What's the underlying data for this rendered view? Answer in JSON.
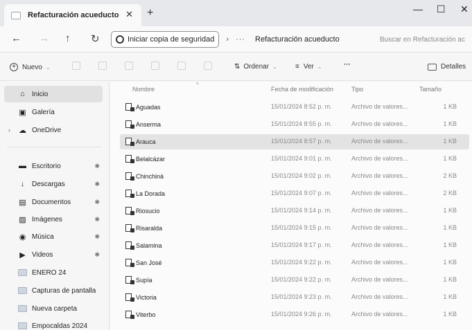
{
  "window": {
    "tab_title": "Refacturación acueducto",
    "close_tab": "✕",
    "new_tab": "+",
    "minimize": "—",
    "maximize": "☐",
    "close": "✕"
  },
  "address": {
    "back": "←",
    "forward": "→",
    "up": "↑",
    "refresh": "↻",
    "backup_label": "Iniciar copia de seguridad",
    "separator": "›",
    "more": "···",
    "current_folder": "Refacturación acueducto",
    "search_placeholder": "Buscar en Refacturación ac"
  },
  "command_bar": {
    "new_label": "Nuevo",
    "sort_label": "Ordenar",
    "view_label": "Ver",
    "more": "···",
    "details_label": "Detalles"
  },
  "sidebar": {
    "top": [
      {
        "label": "Inicio",
        "icon": "home-icon",
        "glyph": "⌂"
      },
      {
        "label": "Galería",
        "icon": "gallery-icon",
        "glyph": "▣"
      },
      {
        "label": "OneDrive",
        "icon": "cloud-icon",
        "glyph": "☁"
      }
    ],
    "quick": [
      {
        "label": "Escritorio",
        "icon": "desktop-icon",
        "glyph": "▬",
        "pinned": true
      },
      {
        "label": "Descargas",
        "icon": "download-icon",
        "glyph": "↓",
        "pinned": true
      },
      {
        "label": "Documentos",
        "icon": "documents-icon",
        "glyph": "▤",
        "pinned": true
      },
      {
        "label": "Imágenes",
        "icon": "pictures-icon",
        "glyph": "▨",
        "pinned": true
      },
      {
        "label": "Música",
        "icon": "music-icon",
        "glyph": "◉",
        "pinned": true
      },
      {
        "label": "Videos",
        "icon": "videos-icon",
        "glyph": "▶",
        "pinned": true
      },
      {
        "label": "ENERO 24",
        "icon": "folder-icon"
      },
      {
        "label": "Capturas de pantalla",
        "icon": "folder-icon"
      },
      {
        "label": "Nueva carpeta",
        "icon": "folder-icon"
      },
      {
        "label": "Empocaldas 2024",
        "icon": "folder-icon"
      }
    ],
    "pin_glyph": "✱"
  },
  "file_list": {
    "headers": {
      "name": "Nombre",
      "date": "Fecha de modificación",
      "type": "Tipo",
      "size": "Tamaño"
    },
    "rows": [
      {
        "name": "Aguadas",
        "date": "15/01/2024 8:52 p. m.",
        "type": "Archivo de valores...",
        "size": "1 KB"
      },
      {
        "name": "Anserma",
        "date": "15/01/2024 8:55 p. m.",
        "type": "Archivo de valores...",
        "size": "1 KB"
      },
      {
        "name": "Arauca",
        "date": "15/01/2024 8:57 p. m.",
        "type": "Archivo de valores...",
        "size": "1 KB",
        "selected": true
      },
      {
        "name": "Belalcázar",
        "date": "15/01/2024 9:01 p. m.",
        "type": "Archivo de valores...",
        "size": "1 KB"
      },
      {
        "name": "Chinchiná",
        "date": "15/01/2024 9:02 p. m.",
        "type": "Archivo de valores...",
        "size": "2 KB"
      },
      {
        "name": "La Dorada",
        "date": "15/01/2024 9:07 p. m.",
        "type": "Archivo de valores...",
        "size": "2 KB"
      },
      {
        "name": "Riosucio",
        "date": "15/01/2024 9:14 p. m.",
        "type": "Archivo de valores...",
        "size": "1 KB"
      },
      {
        "name": "Risaralda",
        "date": "15/01/2024 9:15 p. m.",
        "type": "Archivo de valores...",
        "size": "1 KB"
      },
      {
        "name": "Salamina",
        "date": "15/01/2024 9:17 p. m.",
        "type": "Archivo de valores...",
        "size": "1 KB"
      },
      {
        "name": "San José",
        "date": "15/01/2024 9:22 p. m.",
        "type": "Archivo de valores...",
        "size": "1 KB"
      },
      {
        "name": "Supía",
        "date": "15/01/2024 9:22 p. m.",
        "type": "Archivo de valores...",
        "size": "1 KB"
      },
      {
        "name": "Victoria",
        "date": "15/01/2024 9:23 p. m.",
        "type": "Archivo de valores...",
        "size": "1 KB"
      },
      {
        "name": "Viterbo",
        "date": "15/01/2024 9:26 p. m.",
        "type": "Archivo de valores...",
        "size": "1 KB"
      }
    ]
  }
}
